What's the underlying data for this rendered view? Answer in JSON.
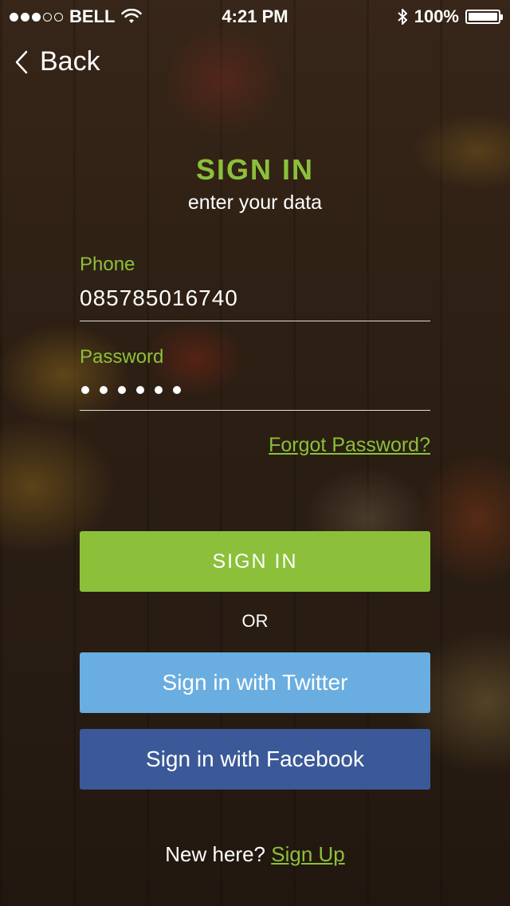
{
  "status_bar": {
    "carrier": "BELL",
    "time": "4:21 PM",
    "battery": "100%",
    "signal_strength": 3,
    "signal_max": 5
  },
  "nav": {
    "back_label": "Back"
  },
  "header": {
    "title": "SIGN IN",
    "subtitle": "enter your data"
  },
  "form": {
    "phone_label": "Phone",
    "phone_value": "085785016740",
    "password_label": "Password",
    "password_length": 6,
    "forgot_label": "Forgot Password?"
  },
  "actions": {
    "signin_label": "SIGN IN",
    "or_label": "OR",
    "twitter_label": "Sign in with Twitter",
    "facebook_label": "Sign in with Facebook"
  },
  "footer": {
    "prompt": "New here?",
    "signup_label": "Sign Up"
  },
  "colors": {
    "accent": "#8cc03a",
    "twitter": "#6aade0",
    "facebook": "#3b5998"
  },
  "icons": {
    "wifi": "wifi-icon",
    "bluetooth": "bluetooth-icon",
    "battery": "battery-icon",
    "back": "chevron-left-icon"
  }
}
